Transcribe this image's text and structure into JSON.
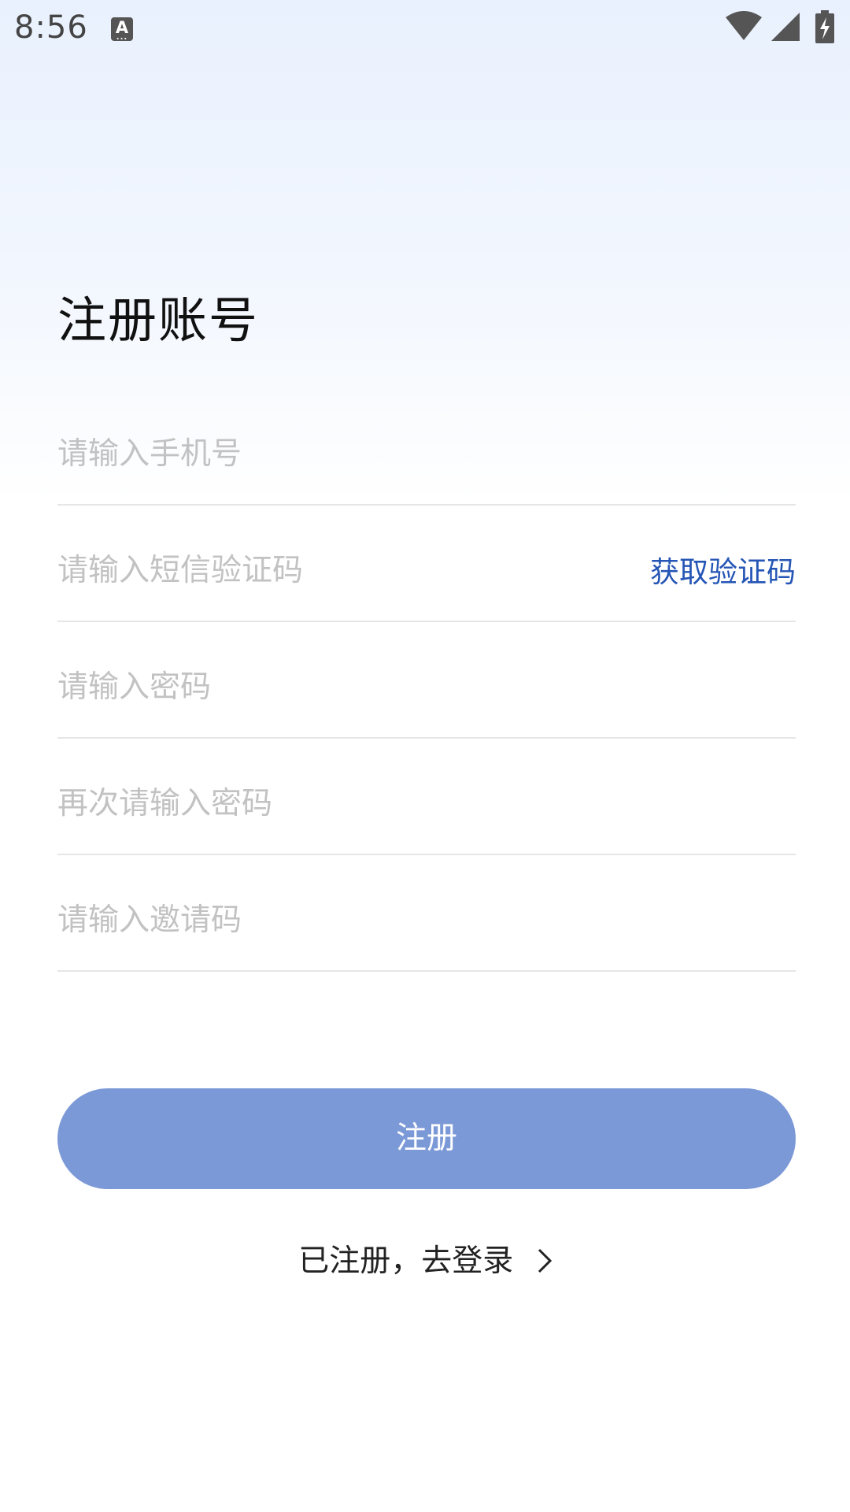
{
  "status_bar": {
    "time": "8:56",
    "notification_icon": "a-icon",
    "notification_letter": "A",
    "icons": [
      "wifi-icon",
      "signal-icon",
      "battery-charging-icon"
    ]
  },
  "page": {
    "title": "注册账号"
  },
  "form": {
    "phone_placeholder": "请输入手机号",
    "sms_code_placeholder": "请输入短信验证码",
    "get_code_label": "获取验证码",
    "password_placeholder": "请输入密码",
    "confirm_password_placeholder": "再次请输入密码",
    "invite_code_placeholder": "请输入邀请码"
  },
  "actions": {
    "register_label": "注册",
    "login_link_label": "已注册，去登录"
  },
  "colors": {
    "accent": "#2555b5",
    "button": "#7c99d7",
    "placeholder": "#c2c2c2"
  }
}
